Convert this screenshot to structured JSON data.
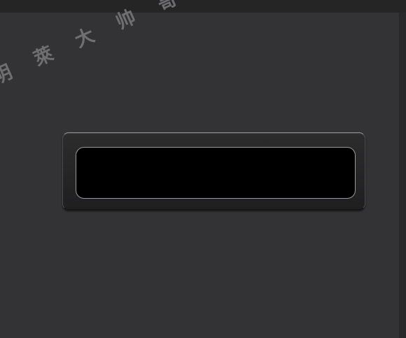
{
  "watermark": {
    "text": "明 萊 大 帅 哥"
  },
  "display": {
    "value": ""
  }
}
